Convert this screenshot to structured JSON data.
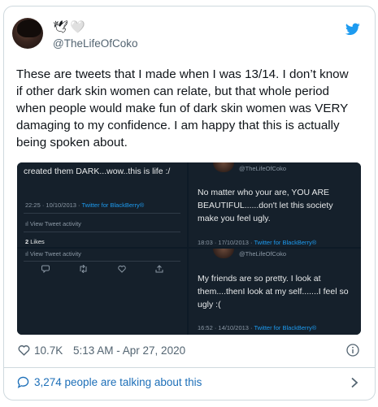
{
  "author": {
    "name_emojis": "🕊🤍",
    "handle": "@TheLifeOfCoko"
  },
  "tweet": {
    "text": "These are tweets that I made when I was 13/14. I don’t know if other dark skin women can relate, but that whole period when people would make fun of dark skin women was VERY damaging to my confidence. I am happy that this is actually being spoken about."
  },
  "media": {
    "top_left": {
      "text": "created them DARK...wow..this is life :/",
      "meta_time": "22:25 · 10/10/2013 · ",
      "meta_client": "Twitter for BlackBerry®",
      "activity": "View Tweet activity",
      "likes_count": "2",
      "likes_label": "Likes"
    },
    "bottom_left": {
      "activity": "View Tweet activity"
    },
    "top_right": {
      "handle": "@TheLifeOfCoko",
      "text": "No matter who your are, YOU ARE BEAUTIFUL......don't let this society make you feel ugly.",
      "meta_time": "18:03 · 17/10/2013 · ",
      "meta_client": "Twitter for BlackBerry®"
    },
    "bottom_right": {
      "handle": "@TheLifeOfCoko",
      "text": "My friends are so pretty. I look at them....thenI look at my self.......I feel so ugly :(",
      "meta_time": "16:52 · 14/10/2013 · ",
      "meta_client": "Twitter for BlackBerry®"
    }
  },
  "footer": {
    "likes": "10.7K",
    "timestamp": "5:13 AM - Apr 27, 2020"
  },
  "conversation": {
    "label": "3,274 people are talking about this"
  },
  "colors": {
    "twitter_blue": "#1d9bf0",
    "dark_bg": "#15202b",
    "text_gray": "#536471"
  }
}
